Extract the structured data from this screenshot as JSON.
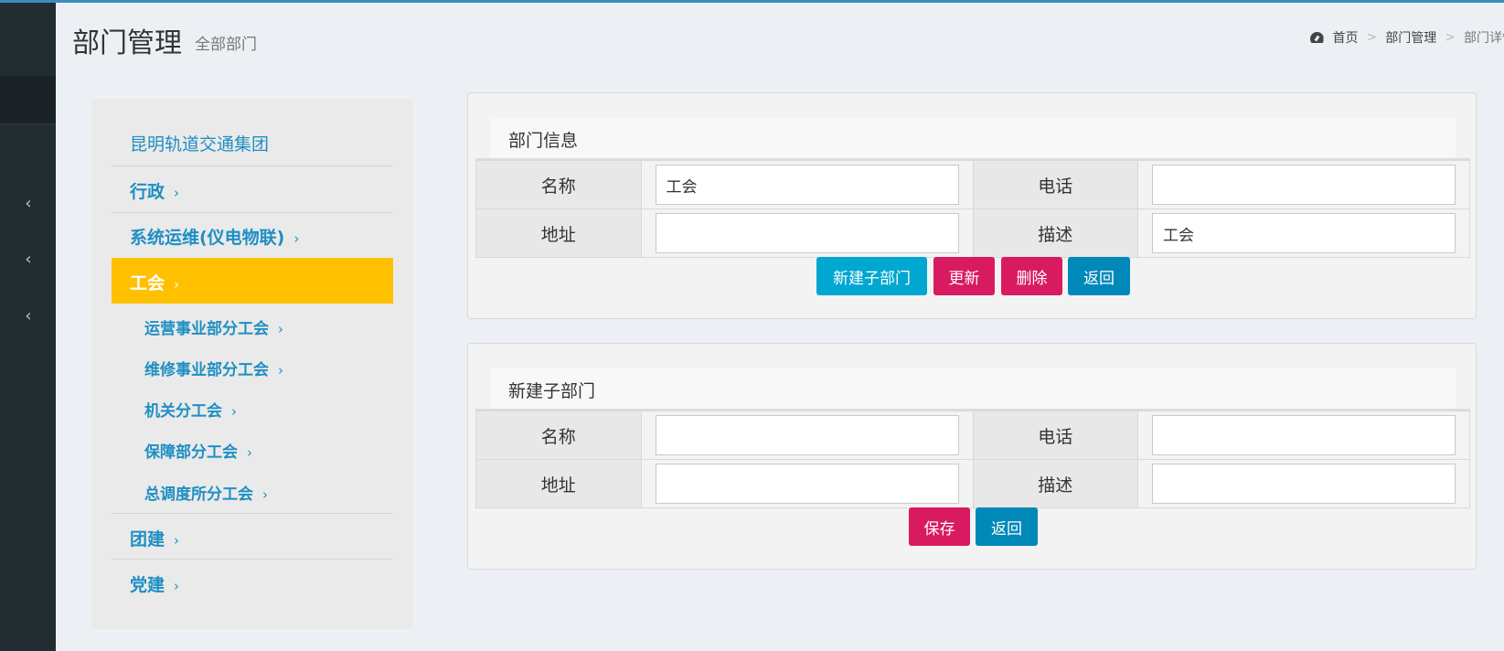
{
  "header": {
    "title": "部门管理",
    "subtitle": "全部部门"
  },
  "breadcrumb": [
    {
      "label": "首页"
    },
    {
      "label": "部门管理"
    },
    {
      "label": "部门详情"
    }
  ],
  "breadcrumb_separator": ">",
  "rail": {
    "chevrons": [
      "‹",
      "‹",
      "‹"
    ]
  },
  "tree": {
    "root": "昆明轨道交通集团",
    "arrow": "›",
    "items": [
      {
        "label": "行政",
        "level": 1
      },
      {
        "label": "系统运维(仪电物联)",
        "level": 1
      },
      {
        "label": "工会",
        "level": 1,
        "active": true
      },
      {
        "label": "运营事业部分工会",
        "level": 2
      },
      {
        "label": "维修事业部分工会",
        "level": 2
      },
      {
        "label": "机关分工会",
        "level": 2
      },
      {
        "label": "保障部分工会",
        "level": 2
      },
      {
        "label": "总调度所分工会",
        "level": 2
      },
      {
        "label": "团建",
        "level": 1
      },
      {
        "label": "党建",
        "level": 1
      }
    ]
  },
  "dept_info": {
    "title": "部门信息",
    "name_label": "名称",
    "name_value": "工会",
    "phone_label": "电话",
    "phone_value": "",
    "address_label": "地址",
    "address_value": "",
    "desc_label": "描述",
    "desc_value": "工会",
    "buttons": {
      "new_sub": "新建子部门",
      "update": "更新",
      "delete": "删除",
      "back": "返回"
    }
  },
  "new_dept": {
    "title": "新建子部门",
    "name_label": "名称",
    "name_value": "",
    "phone_label": "电话",
    "phone_value": "",
    "address_label": "地址",
    "address_value": "",
    "desc_label": "描述",
    "desc_value": "",
    "buttons": {
      "save": "保存",
      "back": "返回"
    }
  },
  "colors": {
    "active_item": "#ffc000",
    "link": "#1f8fc3",
    "info_button": "#00a7d0",
    "danger_button": "#d81b60",
    "primary_button": "#0088b8",
    "sidebar": "#222d32"
  }
}
